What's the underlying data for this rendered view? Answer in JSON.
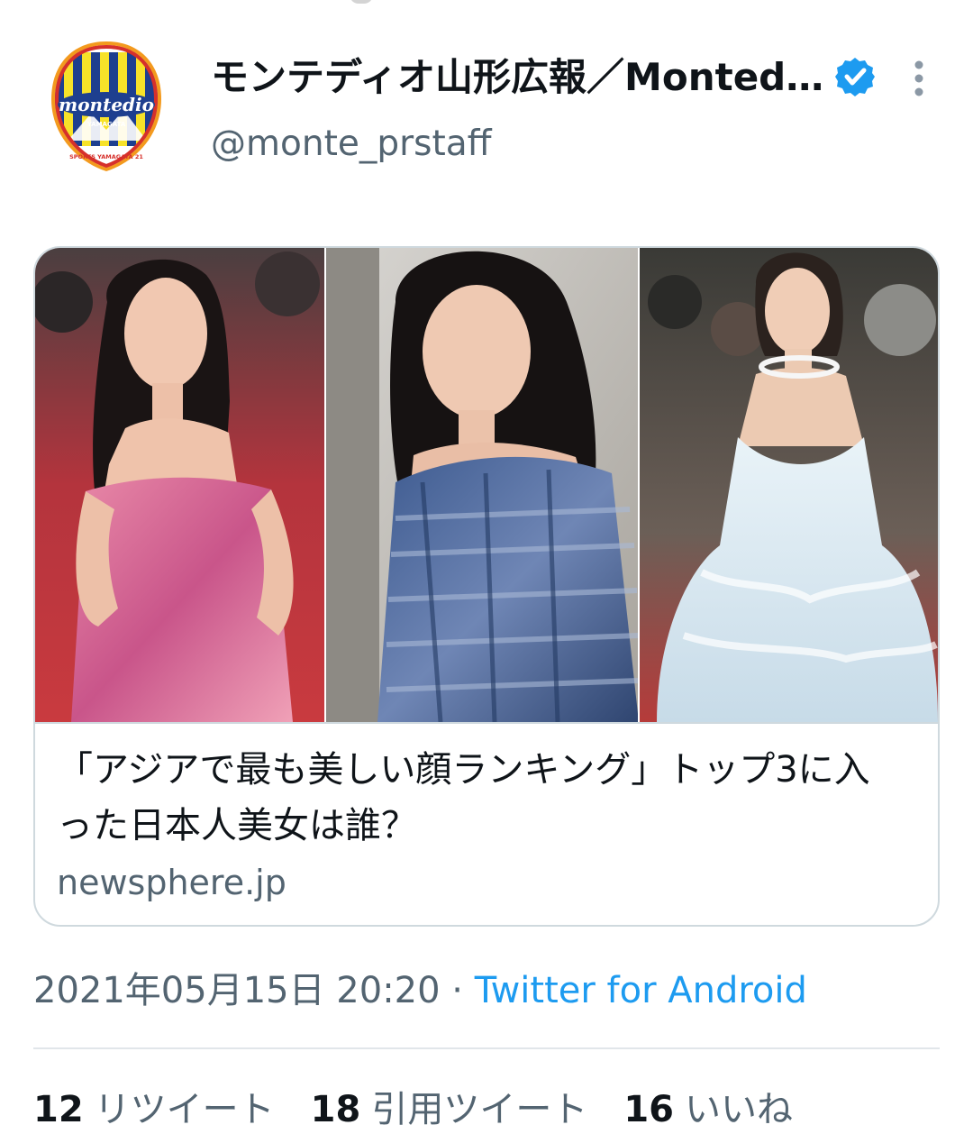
{
  "tweet": {
    "display_name": "モンテディオ山形広報／Monted…",
    "handle": "@monte_prstaff",
    "avatar_text": "montedio",
    "avatar_subtext": "YAMAGATA",
    "avatar_bottom_text": "SPORTS YAMAGATA 21",
    "verified_icon": "verified-badge-icon",
    "more_icon": "more-vertical-icon",
    "colors": {
      "verified": "#1d9bf0",
      "link": "#1d9bf0",
      "secondary_text": "#536471",
      "border": "#cfd9de"
    }
  },
  "card": {
    "image_description": "three photos of women on red carpets",
    "title": "「アジアで最も美しい顔ランキング」トップ3に入った日本人美女は誰？",
    "domain": "newsphere.jp"
  },
  "meta": {
    "timestamp": "2021年05月15日 20:20",
    "separator": " · ",
    "source": "Twitter for Android"
  },
  "stats": {
    "retweets_count": "12",
    "retweets_label": "リツイート",
    "quotes_count": "18",
    "quotes_label": "引用ツイート",
    "likes_count": "16",
    "likes_label": "いいね"
  }
}
